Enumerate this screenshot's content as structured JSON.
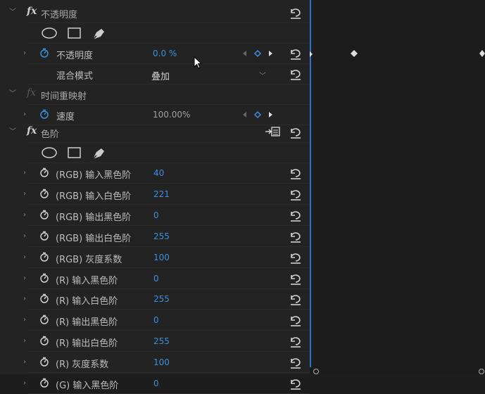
{
  "opacity_section": {
    "label": "不透明度",
    "opacity": {
      "label": "不透明度",
      "value": "0.0 %"
    },
    "blend": {
      "label": "混合模式",
      "value": "叠加"
    }
  },
  "time_remap": {
    "label": "时间重映射",
    "speed": {
      "label": "速度",
      "value": "100.00%"
    }
  },
  "levels": {
    "label": "色阶",
    "params": [
      {
        "label": "(RGB) 输入黑色阶",
        "value": "40"
      },
      {
        "label": "(RGB) 输入白色阶",
        "value": "221"
      },
      {
        "label": "(RGB) 输出黑色阶",
        "value": "0"
      },
      {
        "label": "(RGB) 输出白色阶",
        "value": "255"
      },
      {
        "label": "(RGB) 灰度系数",
        "value": "100"
      },
      {
        "label": "(R) 输入黑色阶",
        "value": "0"
      },
      {
        "label": "(R) 输入白色阶",
        "value": "255"
      },
      {
        "label": "(R) 输出黑色阶",
        "value": "0"
      },
      {
        "label": "(R) 输出白色阶",
        "value": "255"
      },
      {
        "label": "(R) 灰度系数",
        "value": "100"
      },
      {
        "label": "(G) 输入黑色阶",
        "value": "0"
      }
    ]
  },
  "fx_symbol": "fx",
  "colors": {
    "accent": "#3a8fe0",
    "panel": "#232323",
    "timeline": "#1c1c1c"
  },
  "icons": [
    "chevron-icon",
    "stopwatch-icon",
    "reset-icon",
    "ellipse-mask-icon",
    "rect-mask-icon",
    "pen-mask-icon",
    "keyframe-nav-icon",
    "bezier-icon",
    "cursor-icon"
  ]
}
